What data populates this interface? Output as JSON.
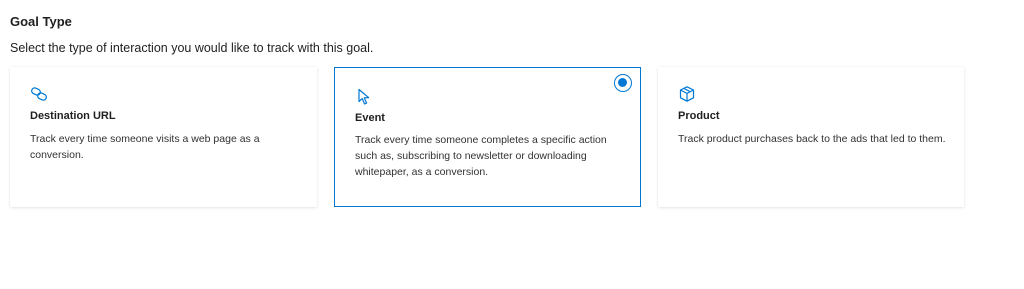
{
  "header": {
    "title": "Goal Type",
    "description": "Select the type of interaction you would like to track with this goal."
  },
  "accent_color": "#0078d4",
  "cards": [
    {
      "icon": "link-icon",
      "title": "Destination URL",
      "description": "Track every time someone visits a web page as a conversion.",
      "selected": false
    },
    {
      "icon": "cursor-pointer-icon",
      "title": "Event",
      "description": "Track every time someone completes a specific action such as, subscribing to newsletter or downloading whitepaper, as a conversion.",
      "selected": true
    },
    {
      "icon": "box-icon",
      "title": "Product",
      "description": "Track product purchases back to the ads that led to them.",
      "selected": false
    }
  ]
}
